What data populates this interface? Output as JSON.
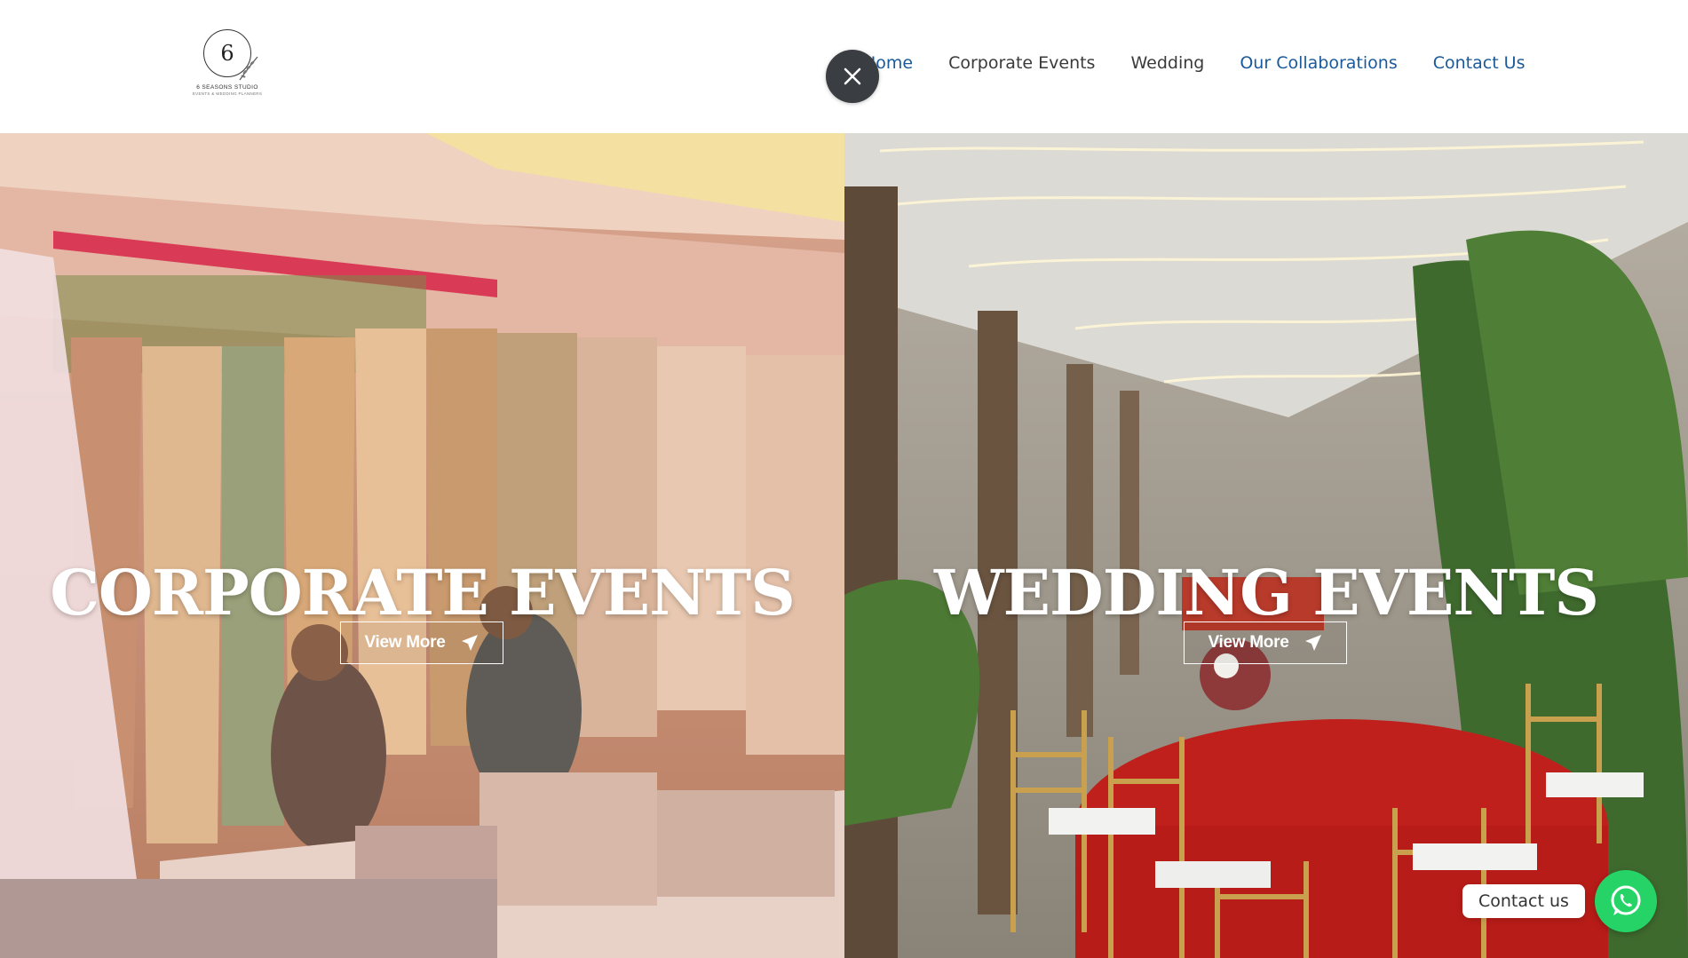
{
  "header": {
    "logo": {
      "mark": "6",
      "brand": "6 SEASONS STUDIO",
      "tagline": "EVENTS & WEDDING PLANNERS"
    },
    "close_icon": "close-icon",
    "nav": [
      {
        "label": "Home",
        "color": "#1a5a9a"
      },
      {
        "label": "Corporate Events",
        "color": "#3a3a3a"
      },
      {
        "label": "Wedding",
        "color": "#3a3a3a"
      },
      {
        "label": "Our Collaborations",
        "color": "#1a5a9a"
      },
      {
        "label": "Contact Us",
        "color": "#1a5a9a"
      }
    ]
  },
  "hero": {
    "left": {
      "title": "CORPORATE EVENTS",
      "button": "View More",
      "button_icon": "send-icon"
    },
    "right": {
      "title": "WEDDING EVENTS",
      "button": "View More",
      "button_icon": "send-icon"
    }
  },
  "contact_widget": {
    "label": "Contact us",
    "icon": "whatsapp-icon",
    "color": "#25d366"
  }
}
